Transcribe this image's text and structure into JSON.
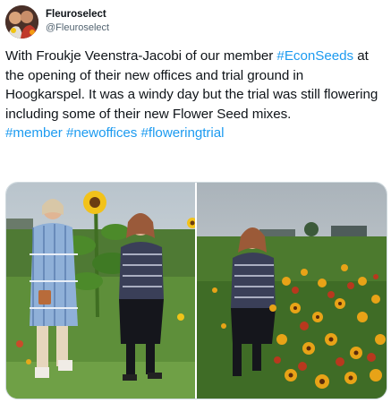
{
  "account": {
    "display_name": "Fleuroselect",
    "handle": "@Fleuroselect"
  },
  "tweet": {
    "text_before_mention": "With Froukje Veenstra-Jacobi of our member ",
    "mention": "#EconSeeds",
    "text_after_mention": " at the opening of their new offices and trial ground in Hoogkarspel. It was a windy day but the trial was still flowering including some of their new Flower Seed mixes.",
    "hashtags": [
      "#member",
      "#newoffices",
      "#floweringtrial"
    ]
  },
  "media": {
    "photo_left_icon": "photo-sunflower-two-women",
    "photo_right_icon": "photo-flower-field-woman"
  },
  "colors": {
    "link": "#1d9bf0",
    "text": "#0f1419",
    "secondary_text": "#536471",
    "border": "#cfd9de"
  }
}
